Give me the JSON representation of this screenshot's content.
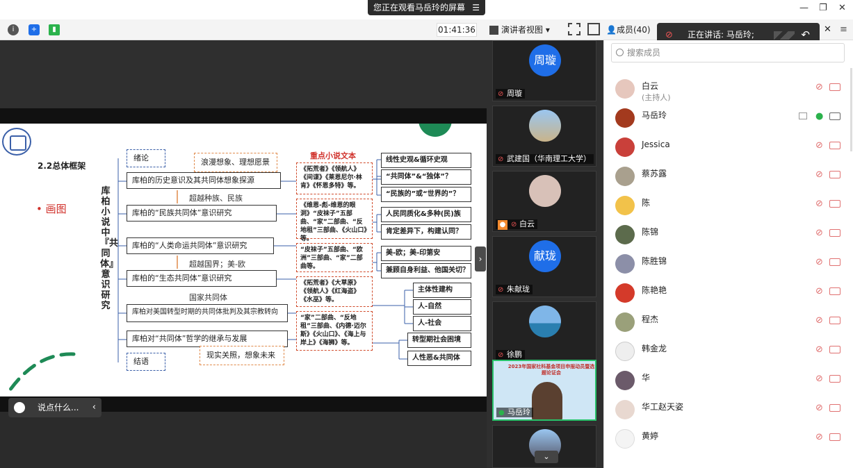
{
  "titlebar": {
    "share_notice": "您正在观看马岳玲的屏幕",
    "menu_icon": "menu-icon",
    "controls": [
      "—",
      "❐",
      "✕"
    ]
  },
  "toolbar": {
    "timer": "01:41:36",
    "presenter_view": "演讲者视图",
    "members_tab": "成员(40)",
    "speaking": "正在讲话: 马岳玲;",
    "icons": [
      "info-icon",
      "shield-icon",
      "signal-icon",
      "fullscreen-icon",
      "layout-icon"
    ],
    "colors": {
      "info": "#555555",
      "shield": "#1f6ee8",
      "signal": "#2bb24c"
    }
  },
  "slide": {
    "heading": "2.2总体框架",
    "drawing_label": "• 画图",
    "vertical_title": "库柏小说中『共同体』意识研究",
    "intro": "绪论",
    "conclusion": "结语",
    "romantic": "浪漫想象、理想愿景",
    "reality": "现实关照，想象未来",
    "rows": [
      "库柏的历史意识及其共同体想象探源",
      "库柏的“民族共同体”意识研究",
      "库柏的“人类命运共同体”意识研究",
      "库柏的“生态共同体”意识研究",
      "库柏对美国转型时期的共同体批判及其宗教转向",
      "库柏对“共同体”哲学的继承与发展"
    ],
    "between": [
      "超越种族、民族",
      "超越国界；美-欧",
      "国家共同体"
    ],
    "books_title": "重点小说文本",
    "books": [
      "《拓荒者》《领航人》《间谍》《莱恩尼尔·林肯》《怀恩多特》等。",
      "《维恩-彪-维恩的眼洞》“皮袜子”五部曲、“家”二部曲、“反地租”三部曲、《火山口》等。",
      "“皮袜子”五部曲、“欧洲”三部曲、“家”二部曲等。",
      "《拓荒者》《大草原》《领航人》《红海盗》《水巫》等。",
      "“家”二部曲、“反地租”三部曲、《内德·迈尔斯》《火山口》、《海上与岸上》《海狮》等。"
    ],
    "right_boxes": [
      "线性史观&循环史观",
      "“共同体”&“独体”？",
      "“民族的”或“世界的”？",
      "人民同质化&多种(民)族",
      "肯定差异下，构建认同？",
      "美-欧；美-印第安",
      "兼顾自身利益、他国关切？",
      "主体性建构",
      "人-自然",
      "人-社会",
      "转型期社会困境",
      "人性恶&共同体"
    ],
    "colors": {
      "accent_red": "#d0302a",
      "accent_blue": "#3a5fa8",
      "deco_green": "#1e8a56"
    }
  },
  "chat": {
    "placeholder": "说点什么..."
  },
  "video_tiles": [
    {
      "name": "周璇",
      "avatar_text": "周璇"
    },
    {
      "name": "武建国（华南理工大学）"
    },
    {
      "name": "白云"
    },
    {
      "name": "朱献珑",
      "avatar_text": "献珑"
    },
    {
      "name": "徐鹏"
    },
    {
      "name": "马岳玲",
      "banner": "2023年国家社科基金项目申报动员暨选题论证会"
    },
    {
      "name": ""
    }
  ],
  "members": {
    "search_placeholder": "搜索成员",
    "list": [
      {
        "name": "白云",
        "role": "(主持人)"
      },
      {
        "name": "马岳玲",
        "role": ""
      },
      {
        "name": "Jessica",
        "role": ""
      },
      {
        "name": "蔡苏露",
        "role": ""
      },
      {
        "name": "陈",
        "role": ""
      },
      {
        "name": "陈锦",
        "role": ""
      },
      {
        "name": "陈胜锦",
        "role": ""
      },
      {
        "name": "陈艳艳",
        "role": ""
      },
      {
        "name": "程杰",
        "role": ""
      },
      {
        "name": "韩金龙",
        "role": ""
      },
      {
        "name": "华",
        "role": ""
      },
      {
        "name": "华工赵天姿",
        "role": ""
      },
      {
        "name": "黄婷",
        "role": ""
      }
    ]
  }
}
